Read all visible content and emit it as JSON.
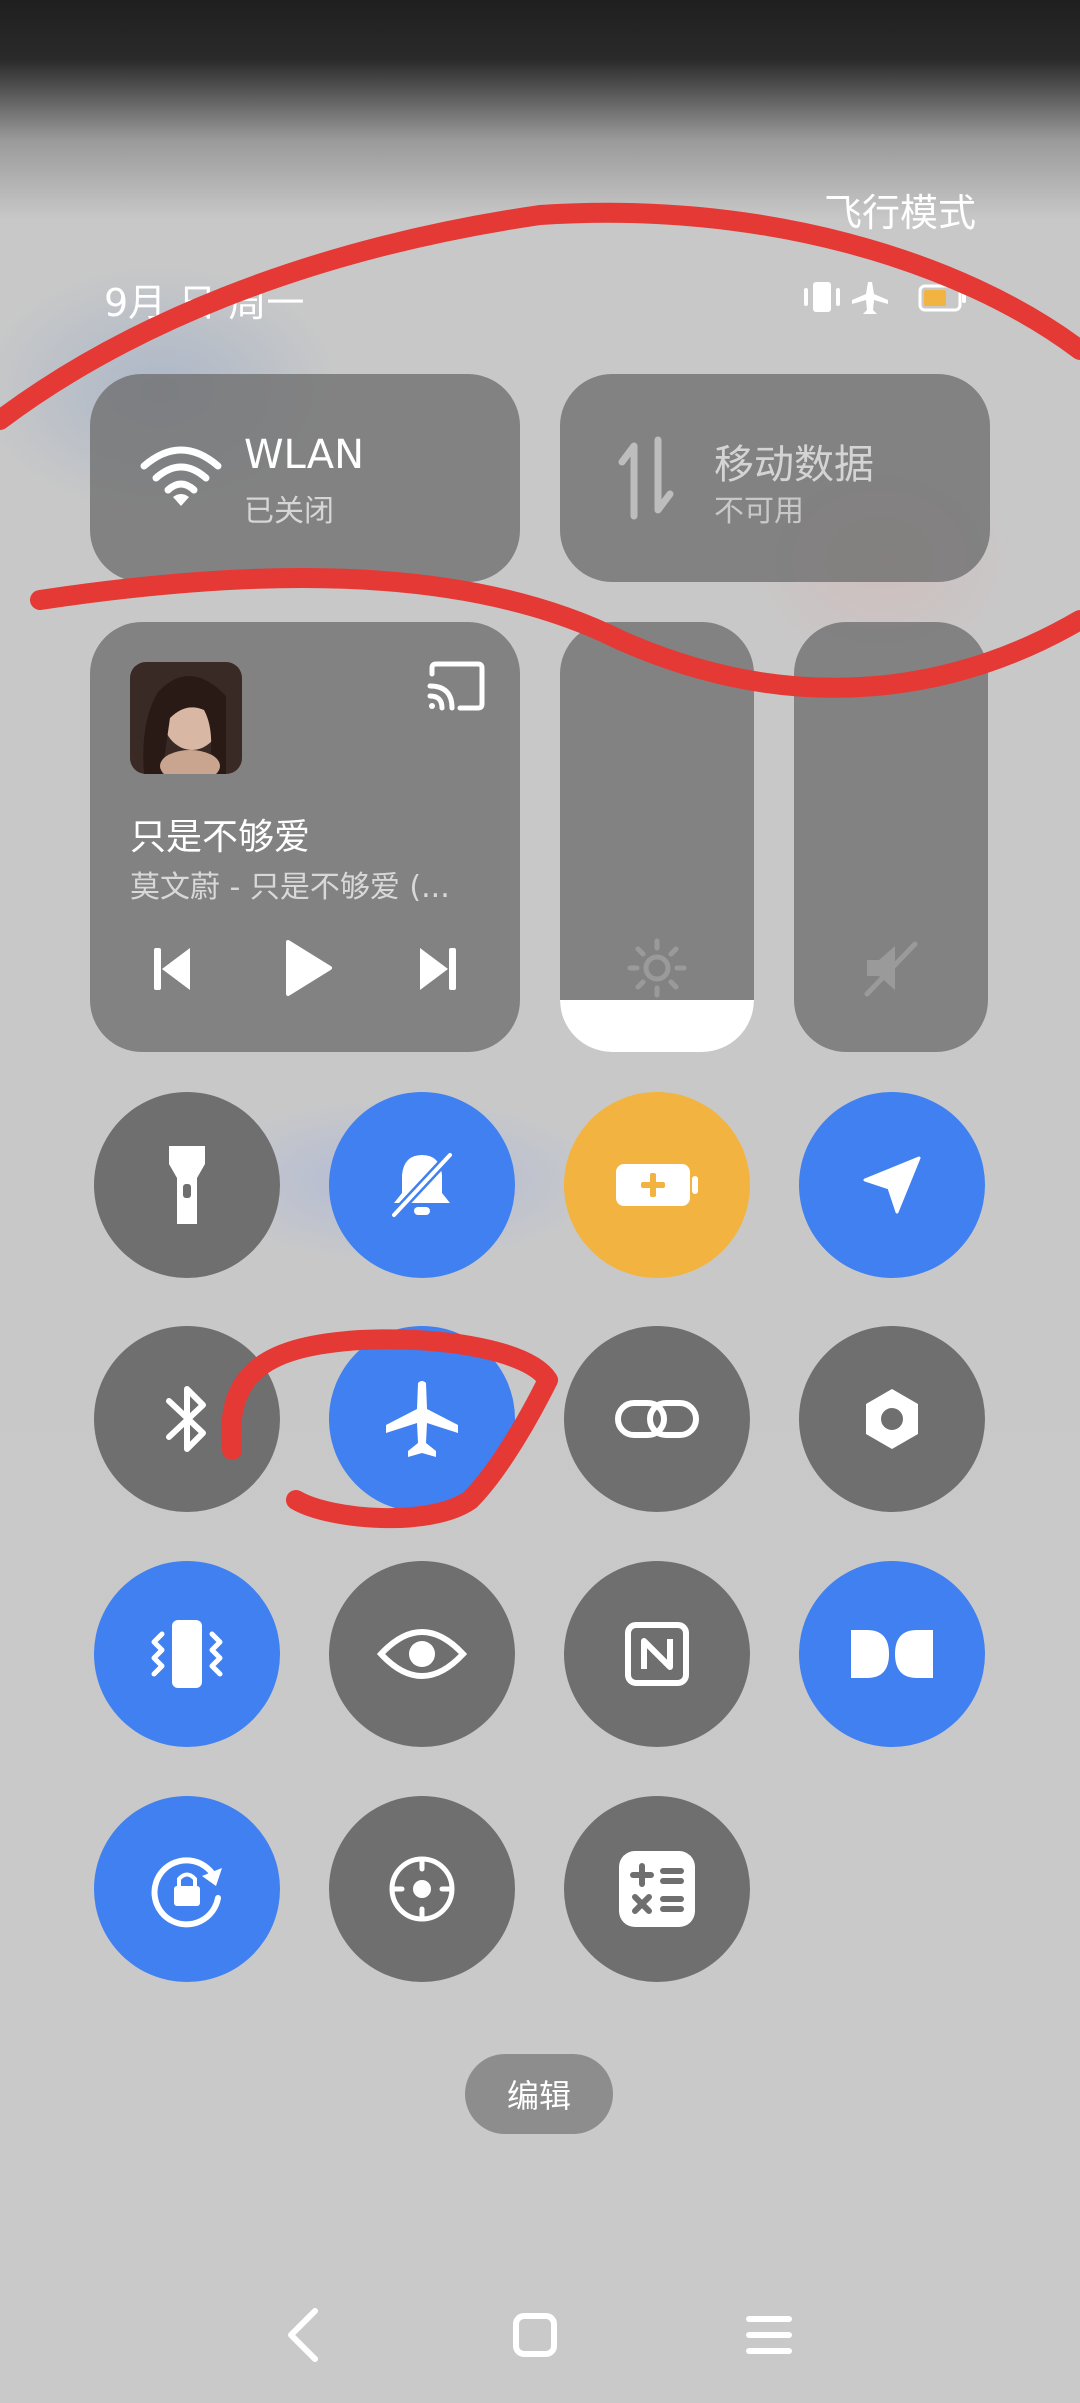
{
  "header": {
    "mode_title": "飞行模式",
    "date": "9月 日 周一"
  },
  "tiles": {
    "wlan": {
      "title": "WLAN",
      "status": "已关闭",
      "icon": "wifi-icon"
    },
    "mobile_data": {
      "title": "移动数据",
      "status": "不可用",
      "icon": "data-arrows-icon"
    }
  },
  "media": {
    "song": "只是不够爱",
    "artist_album": "莫文蔚 - 只是不够爱 (...",
    "icons": [
      "album-art",
      "cast-icon",
      "previous-icon",
      "play-icon",
      "next-icon"
    ]
  },
  "sliders": {
    "brightness_level": 0.12,
    "volume_muted": true
  },
  "toggles": [
    {
      "name": "flashlight",
      "icon": "flashlight-icon",
      "active": false,
      "color": "#6f6f6f"
    },
    {
      "name": "silent",
      "icon": "bell-off-icon",
      "active": true,
      "color": "#4080f0"
    },
    {
      "name": "battery-saver",
      "icon": "battery-plus-icon",
      "active": true,
      "color": "#f2b340"
    },
    {
      "name": "location",
      "icon": "location-arrow-icon",
      "active": true,
      "color": "#4080f0"
    },
    {
      "name": "bluetooth",
      "icon": "bluetooth-icon",
      "active": false,
      "color": "#6f6f6f"
    },
    {
      "name": "airplane-mode",
      "icon": "airplane-icon",
      "active": true,
      "color": "#4080f0"
    },
    {
      "name": "link",
      "icon": "link-icon",
      "active": false,
      "color": "#6f6f6f"
    },
    {
      "name": "settings-hex",
      "icon": "hex-settings-icon",
      "active": false,
      "color": "#6f6f6f"
    },
    {
      "name": "vibrate",
      "icon": "vibrate-icon",
      "active": true,
      "color": "#4080f0"
    },
    {
      "name": "eye-comfort",
      "icon": "eye-icon",
      "active": false,
      "color": "#6f6f6f"
    },
    {
      "name": "nfc",
      "icon": "nfc-icon",
      "active": false,
      "color": "#6f6f6f"
    },
    {
      "name": "dolby",
      "icon": "dolby-icon",
      "active": true,
      "color": "#4080f0"
    },
    {
      "name": "rotation-lock",
      "icon": "rotation-lock-icon",
      "active": true,
      "color": "#4080f0"
    },
    {
      "name": "target",
      "icon": "target-icon",
      "active": false,
      "color": "#6f6f6f"
    },
    {
      "name": "calculator",
      "icon": "calculator-icon",
      "active": false,
      "color": "#6f6f6f"
    }
  ],
  "edit_label": "编辑",
  "navbar": [
    "back-icon",
    "home-icon",
    "menu-icon"
  ],
  "colors": {
    "accent_blue": "#4080f0",
    "accent_orange": "#f2b340",
    "tile_gray": "#6f6f6f",
    "annotation_red": "#e53935"
  }
}
